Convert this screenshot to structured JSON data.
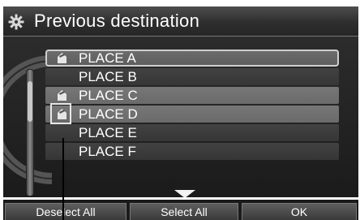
{
  "header": {
    "title": "Previous destination",
    "icon": "gear-icon"
  },
  "list": {
    "items": [
      {
        "label": "PLACE A",
        "has_icon": true,
        "state": "selected"
      },
      {
        "label": "PLACE B",
        "has_icon": false,
        "state": "normal"
      },
      {
        "label": "PLACE C",
        "has_icon": true,
        "state": "highlight"
      },
      {
        "label": "PLACE D",
        "has_icon": true,
        "state": "highlight"
      },
      {
        "label": "PLACE E",
        "has_icon": false,
        "state": "normal"
      },
      {
        "label": "PLACE F",
        "has_icon": false,
        "state": "normal"
      }
    ],
    "item_icon": "checked-mark-icon"
  },
  "footer": {
    "deselect_label": "Deselect All",
    "select_label": "Select All",
    "ok_label": "OK"
  },
  "colors": {
    "background": "#1e1e1e",
    "highlight": "#6e6e6e",
    "text": "#ffffff"
  }
}
